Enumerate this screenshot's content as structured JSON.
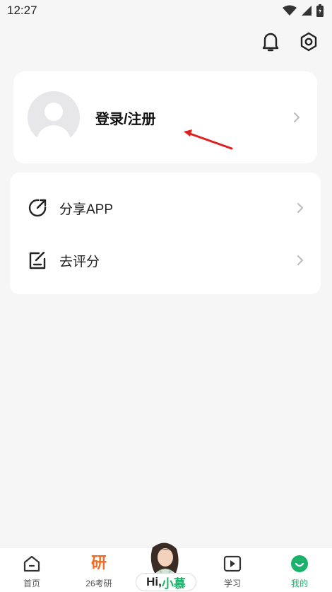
{
  "status": {
    "time": "12:27"
  },
  "header": {
    "bell_icon": "bell-icon",
    "settings_icon": "settings-icon"
  },
  "login": {
    "label": "登录/注册"
  },
  "menu": {
    "items": [
      {
        "label": "分享APP",
        "icon": "share-icon"
      },
      {
        "label": "去评分",
        "icon": "rate-icon"
      }
    ]
  },
  "tabs": [
    {
      "label": "首页",
      "icon": "home-icon"
    },
    {
      "label": "26考研",
      "icon": "yan-icon",
      "glyph": "研"
    },
    {
      "label": "学习",
      "icon": "play-icon"
    },
    {
      "label": "我的",
      "icon": "profile-icon",
      "active": true
    }
  ],
  "assistant": {
    "hi": "Hi,",
    "name": "小慕"
  },
  "colors": {
    "accent": "#1bb36b",
    "orange": "#f26b21",
    "annotation": "#e02020"
  }
}
